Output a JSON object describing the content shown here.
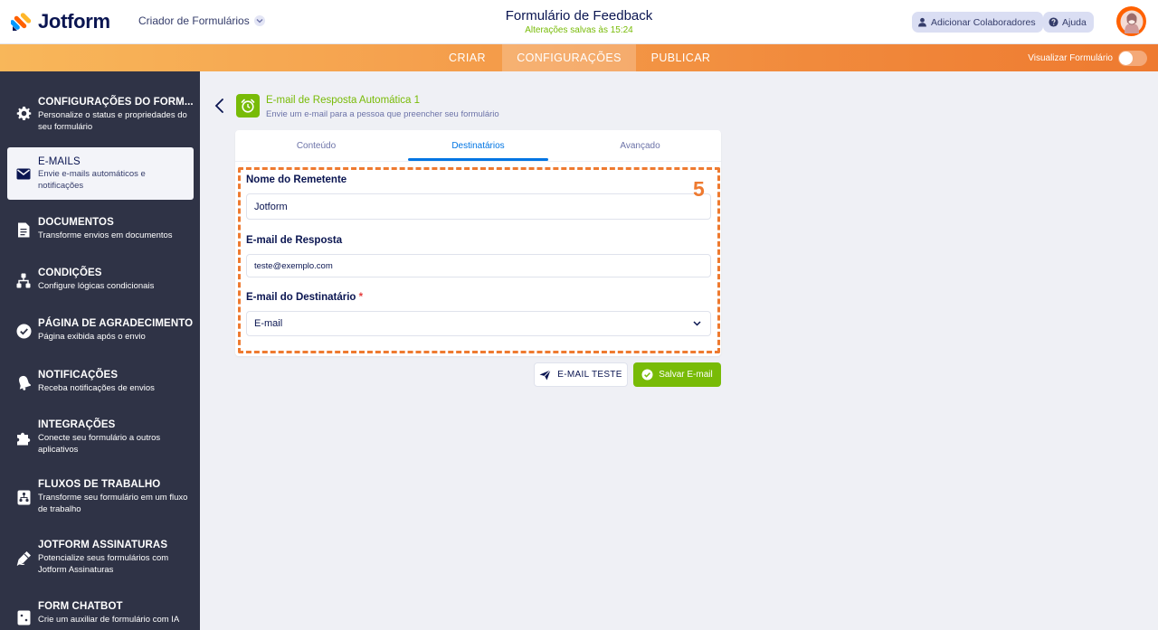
{
  "header": {
    "brand": "Jotform",
    "creator_label": "Criador de Formulários",
    "form_title": "Formulário de Feedback",
    "save_status": "Alterações salvas às 15:24",
    "add_collaborators": "Adicionar Colaboradores",
    "help": "Ajuda"
  },
  "nav": {
    "tabs": [
      {
        "label": "CRIAR",
        "active": false
      },
      {
        "label": "CONFIGURAÇÕES",
        "active": true
      },
      {
        "label": "PUBLICAR",
        "active": false
      }
    ],
    "preview_label": "Visualizar Formulário",
    "preview_enabled": false
  },
  "sidebar": {
    "items": [
      {
        "title": "CONFIGURAÇÕES DO FORM...",
        "desc": "Personalize o status e propriedades do seu formulário",
        "icon": "gear-icon",
        "active": false
      },
      {
        "title": "E-MAILS",
        "desc": "Envie e-mails automáticos e notificações",
        "icon": "envelope-icon",
        "active": true
      },
      {
        "title": "DOCUMENTOS",
        "desc": "Transforme envios em documentos",
        "icon": "document-icon",
        "active": false
      },
      {
        "title": "CONDIÇÕES",
        "desc": "Configure lógicas condicionais",
        "icon": "hierarchy-icon",
        "active": false
      },
      {
        "title": "PÁGINA DE AGRADECIMENTO",
        "desc": "Página exibida após o envio",
        "icon": "check-circle-icon",
        "active": false
      },
      {
        "title": "NOTIFICAÇÕES",
        "desc": "Receba notificações de envios",
        "icon": "bell-icon",
        "active": false
      },
      {
        "title": "INTEGRAÇÕES",
        "desc": "Conecte seu formulário a outros aplicativos",
        "icon": "puzzle-icon",
        "active": false
      },
      {
        "title": "FLUXOS DE TRABALHO",
        "desc": "Transforme seu formulário em um fluxo de trabalho",
        "icon": "workflow-icon",
        "active": false
      },
      {
        "title": "JOTFORM ASSINATURAS",
        "desc": "Potencialize seus formulários com Jotform Assinaturas",
        "icon": "pen-icon",
        "active": false
      },
      {
        "title": "FORM CHATBOT",
        "desc": "Crie um auxiliar de formulário com IA",
        "icon": "chatbot-icon",
        "active": false
      }
    ]
  },
  "main": {
    "card_title": "E-mail de Resposta Automática 1",
    "card_subtitle": "Envie um e-mail para a pessoa que preencher seu formulário",
    "tabs": [
      {
        "label": "Conteúdo",
        "active": false
      },
      {
        "label": "Destinatários",
        "active": true
      },
      {
        "label": "Avançado",
        "active": false
      }
    ],
    "fields": {
      "sender_name_label": "Nome do Remetente",
      "sender_name_value": "Jotform",
      "reply_to_label": "E-mail de Resposta",
      "reply_to_value": "teste@exemplo.com",
      "recipient_label": "E-mail do Destinatário",
      "required_mark": "*",
      "recipient_value": "E-mail"
    },
    "step_number": "5",
    "test_email_button": "E-MAIL TESTE",
    "save_email_button": "Salvar E-mail"
  },
  "colors": {
    "accent_orange": "#ee7a30",
    "success_green": "#78bb07",
    "active_blue": "#0075e3",
    "sidebar_bg": "#2f3346"
  }
}
